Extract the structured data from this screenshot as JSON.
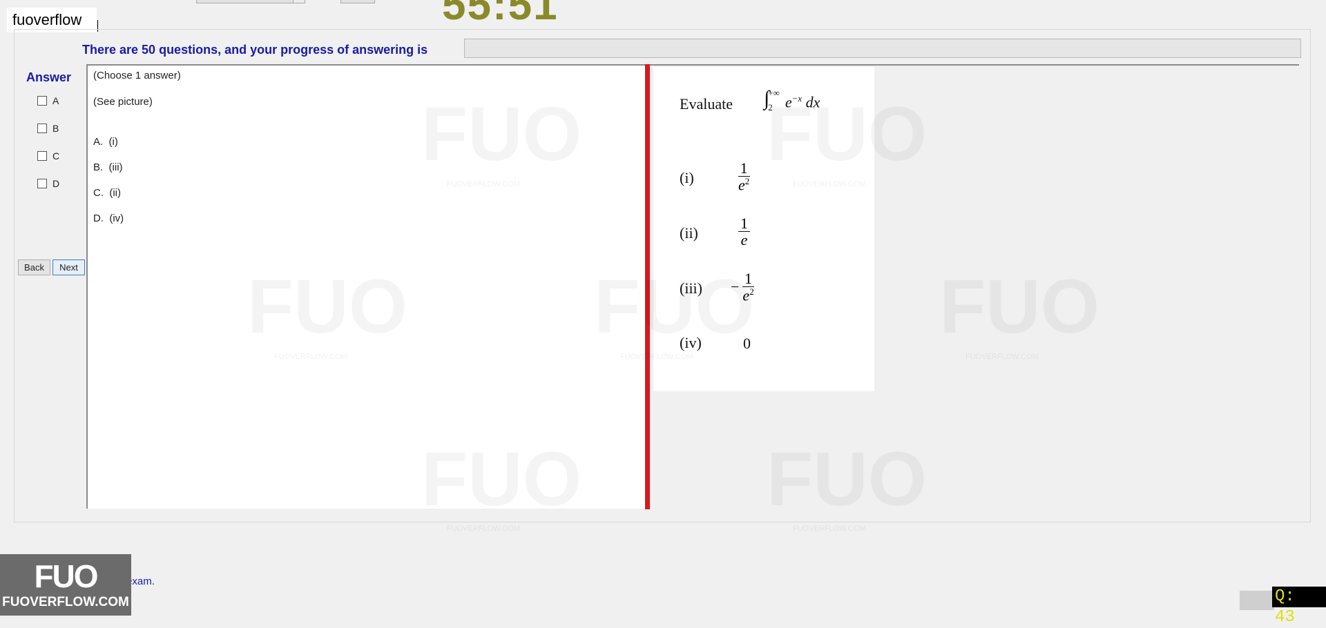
{
  "header": {
    "site_tag": "fuoverflow",
    "timer": "55:51"
  },
  "progress": {
    "label": "There are 50 questions, and your progress of answering is",
    "fraction": 0.0
  },
  "answer_panel": {
    "title": "Answer",
    "options": [
      "A",
      "B",
      "C",
      "D"
    ],
    "back_label": "Back",
    "next_label": "Next"
  },
  "question": {
    "choose_hint": "(Choose 1 answer)",
    "see_picture": "(See picture)",
    "choices": [
      {
        "letter": "A.",
        "text": "(i)"
      },
      {
        "letter": "B.",
        "text": "(iii)"
      },
      {
        "letter": "C.",
        "text": "(ii)"
      },
      {
        "letter": "D.",
        "text": "(iv)"
      }
    ]
  },
  "picture": {
    "evaluate": "Evaluate",
    "integral_lower": "2",
    "integral_upper": "+∞",
    "integrand": "e",
    "integrand_exp": "−x",
    "dx": "dx",
    "items": [
      {
        "label": "(i)",
        "sign": "",
        "num": "1",
        "den": "e",
        "den_exp": "2"
      },
      {
        "label": "(ii)",
        "sign": "",
        "num": "1",
        "den": "e",
        "den_exp": ""
      },
      {
        "label": "(iii)",
        "sign": "−",
        "num": "1",
        "den": "e",
        "den_exp": "2"
      },
      {
        "label": "(iv)",
        "value": "0"
      }
    ]
  },
  "footer": {
    "finish_label": "I want to finish the exam.",
    "logo_mark": "FUO",
    "logo_word": "FUOVERFLOW.COM",
    "q_counter": "Q: 43"
  },
  "watermark": {
    "mark": "FUO",
    "url": "FUOVERFLOW.COM"
  }
}
